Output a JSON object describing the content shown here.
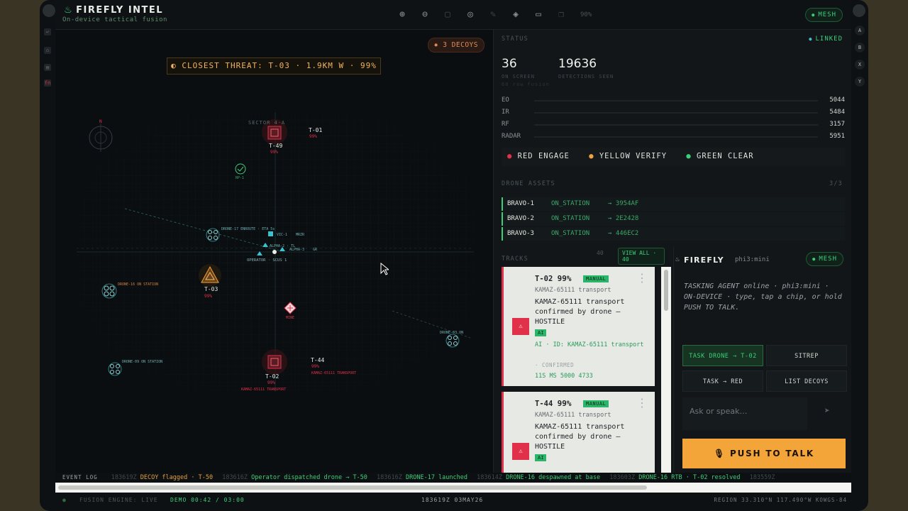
{
  "header": {
    "title": "FIREFLY INTEL",
    "subtitle": "On-device tactical fusion",
    "zoom": "90%",
    "mesh": "MESH"
  },
  "bezel": {
    "left": [
      "↩",
      "⌂",
      "▤",
      "fn"
    ],
    "right": [
      "A",
      "B",
      "X",
      "Y"
    ]
  },
  "map": {
    "decoys": "3 DECOYS",
    "closest_threat": "CLOSEST THREAT: T-03 · 1.9KM W · 99%",
    "sector": "SECTOR 4-A",
    "labels": {
      "t01": "T-01",
      "t01_pct": "99%",
      "t49": "T-49",
      "t49_pct": "99%",
      "t03": "T-03",
      "t03_pct": "99%",
      "t02": "T-02",
      "t02_pct": "99%",
      "t02_desc": "KAMAZ-65111 TRANSPORT",
      "t44": "T-44",
      "t44_pct": "99%",
      "t44_desc": "KAMAZ-65111 TRANSPORT",
      "rp1": "RP-1",
      "mine": "MINE",
      "vic1": "VIC-1",
      "mrzr": "MRZR",
      "alpha2": "ALPHA-2 · TL",
      "alpha3": "ALPHA-3",
      "gr": "GR",
      "opcmd": "OPERATOR · SCUS 1",
      "drone17": "DRONE-17 ENROUTE · ETA 5s",
      "drone16": "DRONE-16 ON STATION",
      "drone03": "DRONE-03 ON",
      "drone09": "DRONE-09 ON STATION"
    }
  },
  "status": {
    "label": "STATUS",
    "linked": "LINKED",
    "on_screen": "36",
    "on_screen_lbl": "ON SCREEN",
    "raw": "60 raw fusion",
    "detections": "19636",
    "detections_lbl": "DETECTIONS SEEN",
    "sensors": [
      {
        "name": "EO",
        "value": "5044"
      },
      {
        "name": "IR",
        "value": "5484"
      },
      {
        "name": "RF",
        "value": "3157"
      },
      {
        "name": "RADAR",
        "value": "5951"
      }
    ],
    "legend": [
      "RED ENGAGE",
      "YELLOW VERIFY",
      "GREEN CLEAR"
    ]
  },
  "drone_assets": {
    "label": "DRONE ASSETS",
    "count": "3/3",
    "items": [
      {
        "name": "BRAVO-1",
        "state": "ON_STATION",
        "target": "→ 3954AF"
      },
      {
        "name": "BRAVO-2",
        "state": "ON_STATION",
        "target": "→ 2E2428"
      },
      {
        "name": "BRAVO-3",
        "state": "ON_STATION",
        "target": "→ 446EC2"
      }
    ]
  },
  "tracks": {
    "label": "TRACKS",
    "count": "40",
    "view_all": "VIEW ALL · 40",
    "cards": [
      {
        "id": "T-02",
        "pct": "99%",
        "badge": "MANUAL",
        "kind": "KAMAZ-65111 transport",
        "desc": "KAMAZ-65111 transport confirmed by drone — HOSTILE",
        "ai": "AI",
        "ai_id": "AI · ID: KAMAZ-65111 transport",
        "confirmed": "· CONFIRMED",
        "coord": "11S MS 5000 4733"
      },
      {
        "id": "T-44",
        "pct": "99%",
        "badge": "MANUAL",
        "kind": "KAMAZ-65111 transport",
        "desc": "KAMAZ-65111 transport confirmed by drone — HOSTILE",
        "ai": "AI",
        "ai_id": "",
        "confirmed": "",
        "coord": ""
      }
    ]
  },
  "agent": {
    "name": "FIREFLY",
    "model": "phi3:mini",
    "mesh": "MESH",
    "message": "TASKING AGENT online · phi3:mini · ON-DEVICE · type, tap a chip, or hold PUSH TO TALK.",
    "chips": [
      "TASK DRONE → T-02",
      "SITREP",
      "TASK → RED",
      "LIST DECOYS"
    ],
    "placeholder": "Ask or speak…",
    "ptt": "PUSH TO TALK"
  },
  "event_log": {
    "label": "EVENT LOG",
    "events": [
      {
        "ts": "183619Z",
        "text": "DECOY flagged · T-50",
        "tone": "o"
      },
      {
        "ts": "183616Z",
        "text": "Operator dispatched drone → T-50",
        "tone": "g"
      },
      {
        "ts": "183616Z",
        "text": "DRONE-17 launched",
        "tone": "g"
      },
      {
        "ts": "183614Z",
        "text": "DRONE-16 despawned at base",
        "tone": "g"
      },
      {
        "ts": "183603Z",
        "text": "DRONE-16 RTB · T-02 resolved",
        "tone": "g"
      },
      {
        "ts": "183559Z",
        "text": "",
        "tone": "g"
      }
    ]
  },
  "footer": {
    "engine": "FUSION ENGINE: LIVE",
    "demo": "DEMO 00:42 / 03:00",
    "time": "183619Z 03MAY26",
    "region": "REGION 33.310°N 117.490°W  KOWGS-84"
  }
}
